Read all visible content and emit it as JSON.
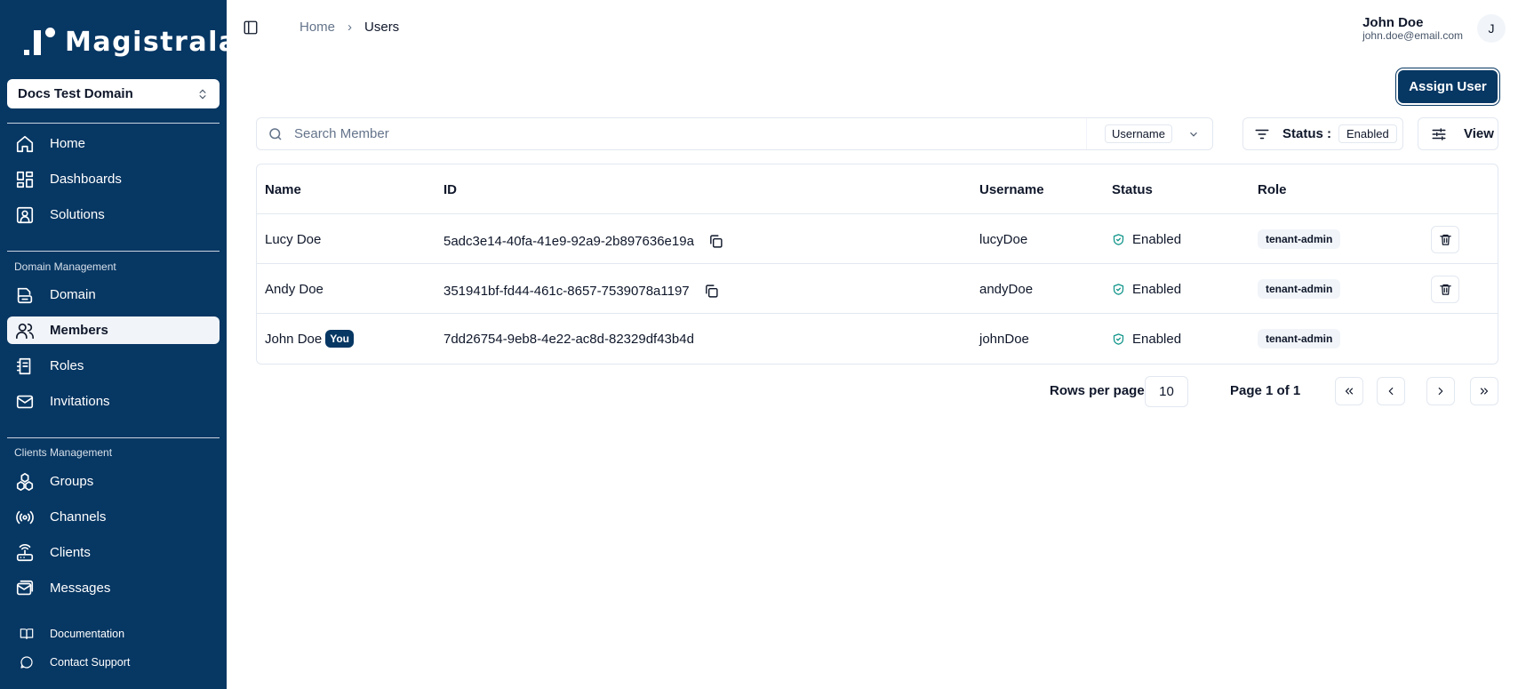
{
  "app": {
    "name": "Magistrala"
  },
  "domain_selector": {
    "value": "Docs Test Domain"
  },
  "sidebar": {
    "main_items": [
      {
        "label": "Home",
        "icon": "home-icon"
      },
      {
        "label": "Dashboards",
        "icon": "dashboard-icon"
      },
      {
        "label": "Solutions",
        "icon": "solutions-icon"
      }
    ],
    "domain_section": {
      "title": "Domain Management",
      "items": [
        {
          "label": "Domain",
          "icon": "domain-icon"
        },
        {
          "label": "Members",
          "icon": "members-icon",
          "active": true
        },
        {
          "label": "Roles",
          "icon": "roles-icon"
        },
        {
          "label": "Invitations",
          "icon": "mail-icon"
        }
      ]
    },
    "clients_section": {
      "title": "Clients Management",
      "items": [
        {
          "label": "Groups",
          "icon": "groups-icon"
        },
        {
          "label": "Channels",
          "icon": "channels-icon"
        },
        {
          "label": "Clients",
          "icon": "clients-icon"
        },
        {
          "label": "Messages",
          "icon": "messages-icon"
        }
      ]
    },
    "footer": [
      {
        "label": "Documentation",
        "icon": "book-icon"
      },
      {
        "label": "Contact Support",
        "icon": "chat-icon"
      }
    ]
  },
  "breadcrumb": {
    "home": "Home",
    "separator": "›",
    "current": "Users"
  },
  "user": {
    "name": "John Doe",
    "email": "john.doe@email.com",
    "initial": "J"
  },
  "actions": {
    "assign_user": "Assign User",
    "view": "View"
  },
  "search": {
    "placeholder": "Search Member",
    "field": "Username"
  },
  "status_filter": {
    "label": "Status :",
    "value": "Enabled"
  },
  "table": {
    "columns": [
      "Name",
      "ID",
      "Username",
      "Status",
      "Role"
    ],
    "rows": [
      {
        "name": "Lucy Doe",
        "id": "5adc3e14-40fa-41e9-92a9-2b897636e19a",
        "username": "lucyDoe",
        "status": "Enabled",
        "role": "tenant-admin"
      },
      {
        "name": "Andy Doe",
        "id": "351941bf-fd44-461c-8657-7539078a1197",
        "username": "andyDoe",
        "status": "Enabled",
        "role": "tenant-admin"
      },
      {
        "name": "John Doe",
        "badge": "You",
        "id": "7dd26754-9eb8-4e22-ac8d-82329df43b4d",
        "username": "johnDoe",
        "status": "Enabled",
        "role": "tenant-admin"
      }
    ]
  },
  "pagination": {
    "rows_label": "Rows per page",
    "rows_value": "10",
    "page_label": "Page 1 of 1"
  },
  "colors": {
    "brand": "#073763",
    "status_ok": "#0e9488"
  }
}
